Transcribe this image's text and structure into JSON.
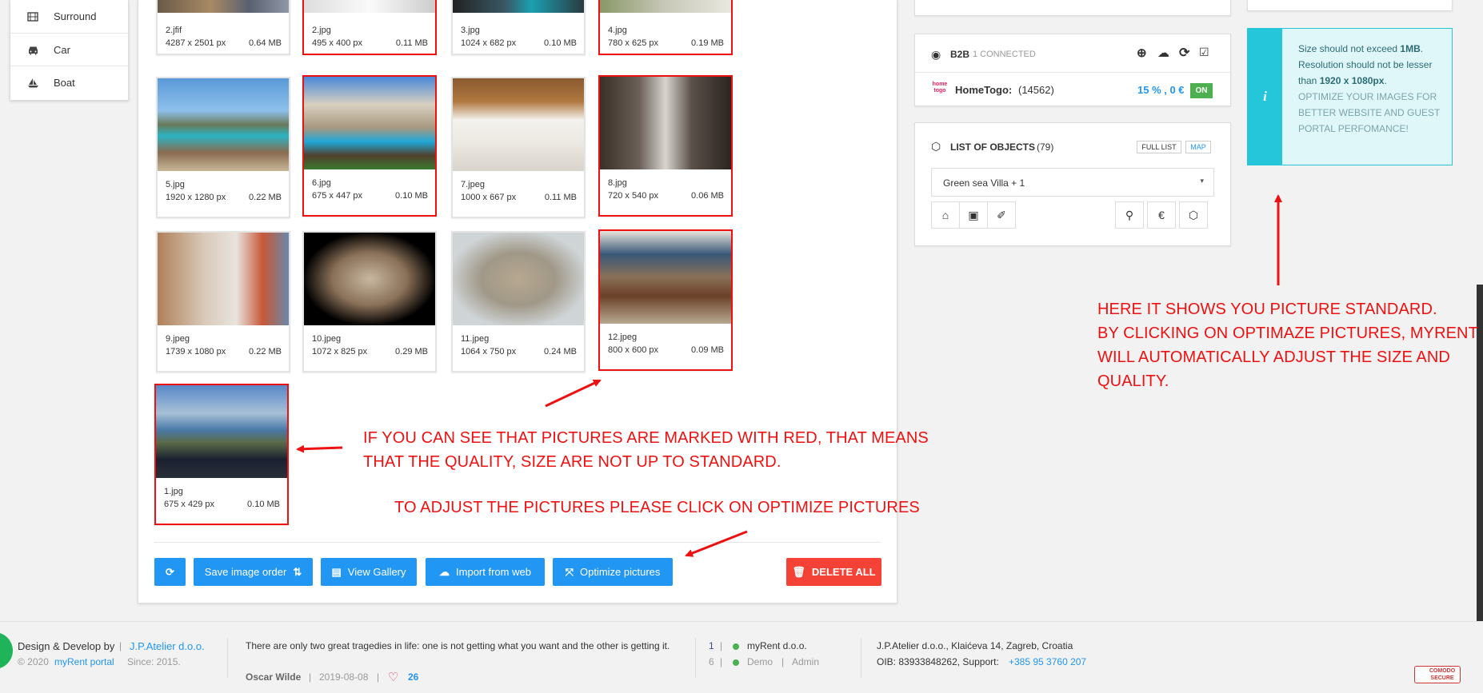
{
  "sidebar": {
    "items": [
      {
        "label": "Surround",
        "icon": "film-icon"
      },
      {
        "label": "Car",
        "icon": "car-icon"
      },
      {
        "label": "Boat",
        "icon": "boat-icon"
      }
    ]
  },
  "images": [
    {
      "name": "2.jfif",
      "dims": "4287 x 2501 px",
      "size": "0.64 MB",
      "flagged": false
    },
    {
      "name": "2.jpg",
      "dims": "495 x 400 px",
      "size": "0.11 MB",
      "flagged": true
    },
    {
      "name": "3.jpg",
      "dims": "1024 x 682 px",
      "size": "0.10 MB",
      "flagged": false
    },
    {
      "name": "4.jpg",
      "dims": "780 x 625 px",
      "size": "0.19 MB",
      "flagged": true
    },
    {
      "name": "5.jpg",
      "dims": "1920 x 1280 px",
      "size": "0.22 MB",
      "flagged": false
    },
    {
      "name": "6.jpg",
      "dims": "675 x 447 px",
      "size": "0.10 MB",
      "flagged": true
    },
    {
      "name": "7.jpeg",
      "dims": "1000 x 667 px",
      "size": "0.11 MB",
      "flagged": false
    },
    {
      "name": "8.jpg",
      "dims": "720 x 540 px",
      "size": "0.06 MB",
      "flagged": true
    },
    {
      "name": "9.jpeg",
      "dims": "1739 x 1080 px",
      "size": "0.22 MB",
      "flagged": false
    },
    {
      "name": "10.jpeg",
      "dims": "1072 x 825 px",
      "size": "0.29 MB",
      "flagged": false
    },
    {
      "name": "11.jpeg",
      "dims": "1064 x 750 px",
      "size": "0.24 MB",
      "flagged": false
    },
    {
      "name": "12.jpeg",
      "dims": "800 x 600 px",
      "size": "0.09 MB",
      "flagged": true
    },
    {
      "name": "1.jpg",
      "dims": "675 x 429 px",
      "size": "0.10 MB",
      "flagged": true
    }
  ],
  "toolbar": {
    "save_order": "Save image order",
    "view_gallery": "View Gallery",
    "import_web": "Import from web",
    "optimize": "Optimize pictures",
    "delete_all": "DELETE ALL"
  },
  "b2b": {
    "title": "B2B",
    "connected": "1 CONNECTED",
    "partner_logo": "home togo",
    "partner_name": "HomeTogo:",
    "partner_id": "(14562)",
    "commission": "15 % , 0 €",
    "status": "ON"
  },
  "objects": {
    "title": "LIST OF OBJECTS",
    "count": "(79)",
    "full_list": "FULL LIST",
    "map": "MAP",
    "selected": "Green sea Villa + 1"
  },
  "info": {
    "line1a": "Size should not exceed ",
    "line1b": "1MB",
    "line1c": ".",
    "line2a": "Resolution should not be lesser than ",
    "line2b": "1920 x 1080px",
    "line2c": ".",
    "line3": "OPTIMIZE YOUR IMAGES FOR BETTER WEBSITE AND GUEST PORTAL PERFOMANCE!"
  },
  "annotations": {
    "note1_l1": "IF YOU CAN SEE THAT PICTURES ARE MARKED WITH RED, THAT MEANS",
    "note1_l2": "THAT THE QUALITY, SIZE ARE NOT UP TO STANDARD.",
    "note2": "TO ADJUST THE PICTURES PLEASE CLICK ON OPTIMIZE PICTURES",
    "note3_l1": "HERE IT SHOWS YOU PICTURE STANDARD.",
    "note3_l2": "BY CLICKING ON OPTIMAZE PICTURES, MYRENT",
    "note3_l3": "WILL AUTOMATICALLY ADJUST THE SIZE AND",
    "note3_l4": "QUALITY."
  },
  "footer": {
    "design_by": "Design & Develop by",
    "pipe": "|",
    "company": "J.P.Atelier d.o.o.",
    "copyright": "© 2020",
    "portal": "myRent portal",
    "since": "Since: 2015.",
    "quote": "There are only two great tragedies in life: one is not getting what you want and the other is getting it.",
    "author": "Oscar Wilde",
    "date": "2019-08-08",
    "likes": "26",
    "row1_num": "1",
    "row1_name": "myRent d.o.o.",
    "row2_num": "6",
    "row2_name": "Demo",
    "row2_role": "Admin",
    "address": "J.P.Atelier d.o.o., Klaićeva 14, Zagreb, Croatia",
    "oib": "OIB: 83933848262, Support:",
    "phone": "+385 95 3760 207",
    "badge": "COMODO SECURE"
  }
}
